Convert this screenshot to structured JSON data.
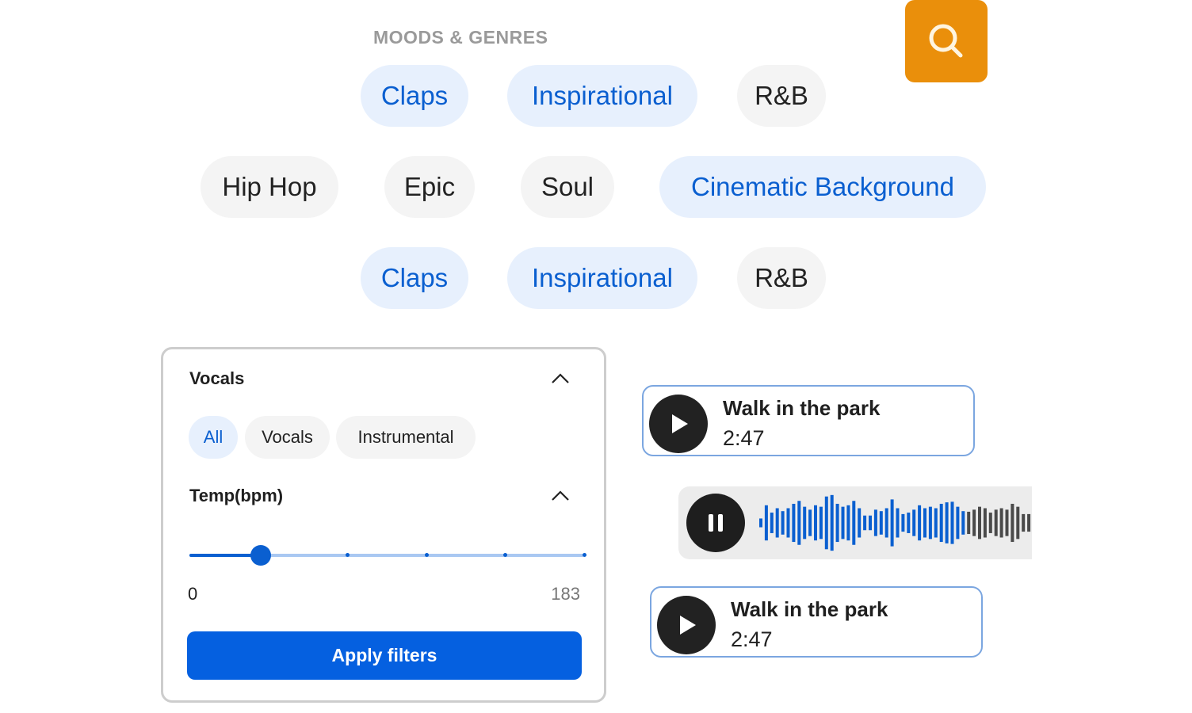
{
  "moods": {
    "title": "MOODS & GENRES",
    "search_icon": "search-icon",
    "rows": [
      [
        {
          "label": "Claps",
          "selected": true
        },
        {
          "label": "Inspirational",
          "selected": true
        },
        {
          "label": "R&B",
          "selected": false
        }
      ],
      [
        {
          "label": "Hip Hop",
          "selected": false
        },
        {
          "label": "Epic",
          "selected": false
        },
        {
          "label": "Soul",
          "selected": false
        },
        {
          "label": "Cinematic Background",
          "selected": true
        }
      ],
      [
        {
          "label": "Claps",
          "selected": true
        },
        {
          "label": "Inspirational",
          "selected": true
        },
        {
          "label": "R&B",
          "selected": false
        }
      ]
    ]
  },
  "filters": {
    "vocals": {
      "heading": "Vocals",
      "options": [
        {
          "label": "All",
          "selected": true
        },
        {
          "label": "Vocals",
          "selected": false
        },
        {
          "label": "Instrumental",
          "selected": false
        }
      ]
    },
    "tempo": {
      "heading": "Temp(bpm)",
      "min_label": "0",
      "max_label": "183",
      "min": 0,
      "max": 183,
      "value_fraction": 0.18,
      "steps": 6
    },
    "apply_label": "Apply filters"
  },
  "tracks": [
    {
      "title": "Walk in the park",
      "duration": "2:47",
      "state": "paused"
    },
    {
      "title": "Walk in the park",
      "duration": "2:47",
      "state": "paused"
    }
  ],
  "player": {
    "state": "playing",
    "progress_fraction": 0.76,
    "played_color": "#0a5fd0",
    "unplayed_color": "#4a4a4a",
    "amplitudes": [
      0.15,
      0.6,
      0.35,
      0.5,
      0.4,
      0.5,
      0.65,
      0.75,
      0.55,
      0.45,
      0.6,
      0.55,
      0.9,
      0.95,
      0.65,
      0.55,
      0.6,
      0.75,
      0.5,
      0.25,
      0.25,
      0.45,
      0.4,
      0.5,
      0.8,
      0.5,
      0.3,
      0.35,
      0.45,
      0.6,
      0.5,
      0.55,
      0.5,
      0.65,
      0.7,
      0.72,
      0.55,
      0.4,
      0.38,
      0.45,
      0.55,
      0.5,
      0.35,
      0.45,
      0.5,
      0.45,
      0.65,
      0.55,
      0.3,
      0.3
    ]
  }
}
